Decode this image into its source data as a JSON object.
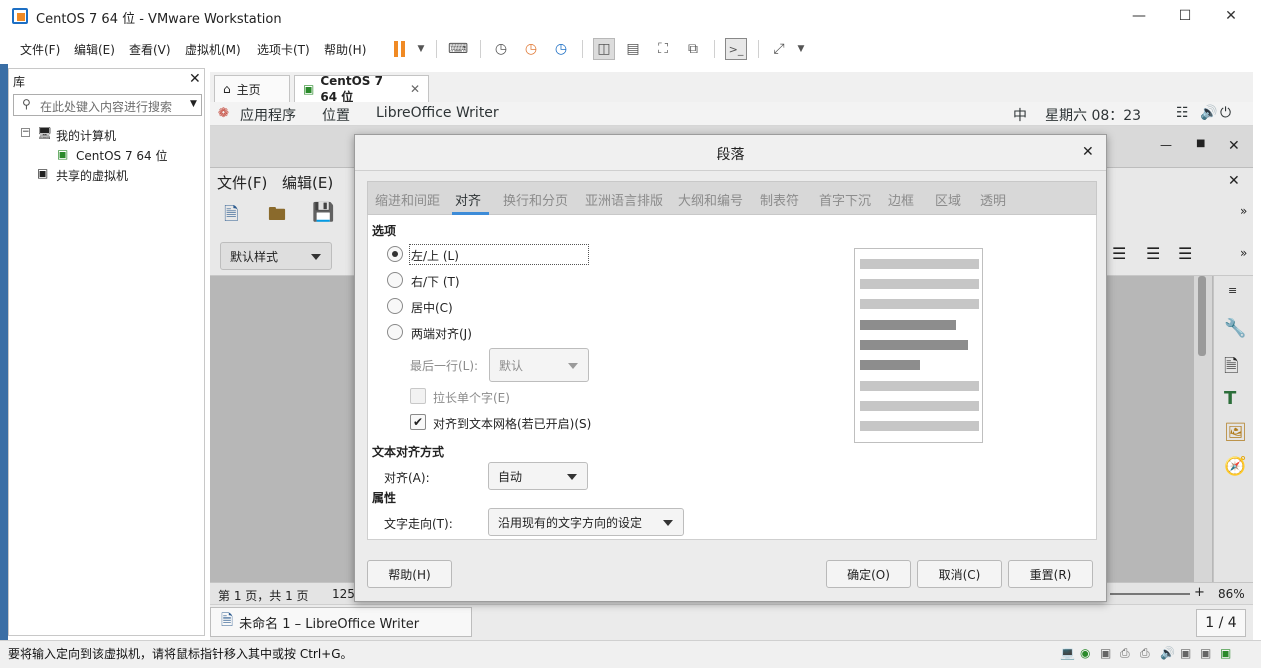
{
  "window": {
    "title": "CentOS 7 64 位 - VMware Workstation"
  },
  "vm_menu": [
    "文件(F)",
    "编辑(E)",
    "查看(V)",
    "虚拟机(M)",
    "选项卡(T)",
    "帮助(H)"
  ],
  "library": {
    "title": "库",
    "search_placeholder": "在此处键入内容进行搜索",
    "tree": [
      "我的计算机",
      "CentOS 7 64 位",
      "共享的虚拟机"
    ]
  },
  "tabs": [
    {
      "label": "主页"
    },
    {
      "label": "CentOS 7 64 位"
    }
  ],
  "gnome": {
    "apps": "应用程序",
    "places": "位置",
    "active_app": "LibreOffice Writer",
    "input_method": "中",
    "clock": "星期六 08：23"
  },
  "writer": {
    "menu": [
      "文件(F)",
      "编辑(E)"
    ],
    "style_box": "默认样式",
    "status_page": "第 1 页，共 1 页",
    "status_words": "125",
    "zoom": "86%"
  },
  "taskbar": {
    "window_label": "未命名 1 – LibreOffice Writer",
    "workspace": "1 / 4"
  },
  "dialog": {
    "title": "段落",
    "tabs": [
      "缩进和间距",
      "对齐",
      "换行和分页",
      "亚洲语言排版",
      "大纲和编号",
      "制表符",
      "首字下沉",
      "边框",
      "区域",
      "透明"
    ],
    "active_tab_index": 1,
    "options_heading": "选项",
    "radios": [
      "左/上 (L)",
      "右/下 (T)",
      "居中(C)",
      "两端对齐(J)"
    ],
    "selected_radio_index": 0,
    "last_line_label": "最后一行(L):",
    "last_line_value": "默认",
    "stretch_single_word": "拉长单个字(E)",
    "stretch_checked": false,
    "snap_to_grid": "对齐到文本网格(若已开启)(S)",
    "snap_checked": true,
    "text_align_heading": "文本对齐方式",
    "align_label": "对齐(A):",
    "align_value": "自动",
    "properties_heading": "属性",
    "direction_label": "文字走向(T):",
    "direction_value": "沿用现有的文字方向的设定",
    "buttons": {
      "help": "帮助(H)",
      "ok": "确定(O)",
      "cancel": "取消(C)",
      "reset": "重置(R)"
    }
  },
  "statusbar": {
    "message": "要将输入定向到该虚拟机，请将鼠标指针移入其中或按 Ctrl+G。"
  },
  "colors": {
    "accent_tab_underline": "#3d8cd8",
    "vmware_orange": "#f08a24",
    "preview_dark": "#8d8d8d",
    "preview_light": "#c6c6c6"
  }
}
